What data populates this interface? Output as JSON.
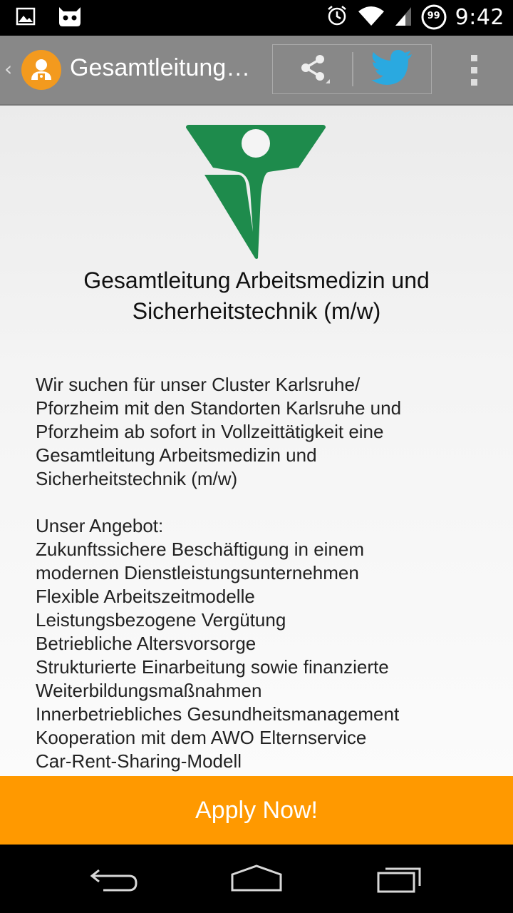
{
  "status_bar": {
    "time": "9:42",
    "battery_level": "99",
    "icons": [
      "gallery-notification-icon",
      "cyanogen-mascot-icon",
      "alarm-icon",
      "wifi-icon",
      "signal-icon",
      "battery-icon"
    ]
  },
  "action_bar": {
    "title": "Gesamtleitung…",
    "app_icon": "user-avatar-icon",
    "actions": [
      "share-icon",
      "twitter-icon",
      "overflow-menu-icon"
    ]
  },
  "job": {
    "logo": "awo-logo",
    "logo_color": "#1e8b4c",
    "title": "Gesamtleitung Arbeitsmedizin und Sicherheitstechnik (m/w)",
    "intro_lines": [
      "Wir suchen für unser Cluster Karlsruhe/",
      "Pforzheim mit den Standorten Karlsruhe und",
      "Pforzheim ab sofort in Vollzeittätigkeit eine",
      "Gesamtleitung Arbeitsmedizin und",
      "Sicherheitstechnik (m/w)"
    ],
    "offer_heading": "Unser Angebot:",
    "offer_lines": [
      "Zukunftssichere Beschäftigung in einem",
      "modernen Dienstleistungsunternehmen",
      "Flexible Arbeitszeitmodelle",
      "Leistungsbezogene Vergütung",
      "Betriebliche Altersvorsorge",
      "Strukturierte Einarbeitung sowie finanzierte",
      "Weiterbildungsmaßnahmen",
      "Innerbetriebliches Gesundheitsmanagement",
      "Kooperation mit dem AWO Elternservice",
      "Car-Rent-Sharing-Modell"
    ]
  },
  "apply_button": {
    "label": "Apply Now!",
    "color": "#ff9900"
  },
  "nav_bar": {
    "buttons": [
      "back-icon",
      "home-icon",
      "recent-apps-icon"
    ]
  },
  "colors": {
    "action_bar": "#888888",
    "accent": "#ff9900",
    "twitter": "#2aa9e0"
  }
}
